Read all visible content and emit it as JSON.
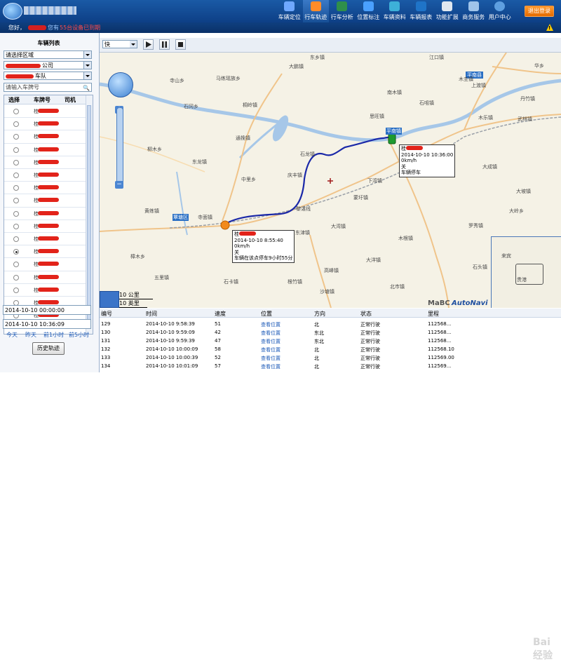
{
  "nav": {
    "items": [
      {
        "label": "车辆定位",
        "color": "#6fa8ff"
      },
      {
        "label": "行车轨迹",
        "color": "#ff8c2a"
      },
      {
        "label": "行车分析",
        "color": "#2f8f4a"
      },
      {
        "label": "位置标注",
        "color": "#4aa0ff"
      },
      {
        "label": "车辆资料",
        "color": "#3db0d8"
      },
      {
        "label": "车辆报表",
        "color": "#1f74c8"
      },
      {
        "label": "功能扩展",
        "color": "#e0e8f0"
      },
      {
        "label": "商务服务",
        "color": "#9fc4ea"
      },
      {
        "label": "用户中心",
        "color": "#5e9fe0"
      }
    ],
    "logout": "退出登录"
  },
  "welcome": {
    "greeting": "您好，",
    "you_have": "您有",
    "notice": "55台设备已到期"
  },
  "sidebar": {
    "title": "车辆列表",
    "region_select": "请选择区域",
    "company_select": "公司",
    "fleet_select": "车队",
    "search_placeholder": "请输入车牌号",
    "columns": {
      "select": "选择",
      "plate": "车牌号",
      "driver": "司机"
    },
    "plate_prefix": "桂",
    "start_time": "2014-10-10 00:00:00",
    "end_time": "2014-10-10 10:36:09",
    "quick": {
      "today": "今天",
      "yesterday": "昨天",
      "hour1": "前1小时",
      "hour5": "前5小时"
    },
    "history_button": "历史轨迹"
  },
  "playback": {
    "speed": "快"
  },
  "map": {
    "places": [
      "东乡镇",
      "江口镇",
      "华乡",
      "平南县",
      "寺山乡",
      "马练瑶族乡",
      "大鹏镇",
      "木圭镇",
      "上渡镇",
      "南木镇",
      "丹竹镇",
      "石冈乡",
      "桐岭镇",
      "石咀镇",
      "思旺镇",
      "木乐镇",
      "武林镇",
      "通挽镇",
      "平南镇",
      "大成镇",
      "柳木乡",
      "东龙镇",
      "石龙镇",
      "庆丰镇",
      "中里乡",
      "下湾镇",
      "大坡镇",
      "黄练镇",
      "覃塘区",
      "黎湛线",
      "大岭乡",
      "寺面镇",
      "蒙圩镇",
      "罗秀镇",
      "东津镇",
      "木根镇",
      "大湾镇",
      "石卡镇",
      "大洋镇",
      "高峰镇",
      "石头镇",
      "樟木乡",
      "五里镇",
      "根竹镇",
      "沙塘镇",
      "北市镇",
      "六陈镇",
      "桥圩镇",
      "八塘镇",
      "黄林镇",
      "大沟镇",
      "来宾",
      "贵港",
      "石卡镇",
      "桂平市",
      "石咀镇",
      "白沙镇",
      "峡州镇"
    ],
    "end_marker": {
      "plate": "桂",
      "time": "2014-10-10 10:36:00",
      "speed": "0km/h",
      "status": "关",
      "event": "车辆停车"
    },
    "start_marker": {
      "plate": "桂",
      "time": "2014-10-10 8:55:40",
      "speed": "0km/h",
      "status": "关",
      "event": "车辆在该点停车9小时55分"
    },
    "scale_km": "10 公里",
    "scale_mi": "10 英里",
    "brand_a": "MaBC",
    "brand_b": "AutoNavi",
    "minimap_a": "来宾",
    "minimap_b": "贵港"
  },
  "records": {
    "columns": {
      "id": "编号",
      "time": "时间",
      "speed": "速度",
      "location": "位置",
      "direction": "方向",
      "status": "状态",
      "mileage": "里程"
    },
    "rows": [
      {
        "id": "129",
        "time": "2014-10-10 9:58:39",
        "speed": "51",
        "location": "查看位置",
        "direction": "北",
        "status": "正常行驶",
        "mileage": "112568..."
      },
      {
        "id": "130",
        "time": "2014-10-10 9:59:09",
        "speed": "42",
        "location": "查看位置",
        "direction": "东北",
        "status": "正常行驶",
        "mileage": "112568..."
      },
      {
        "id": "131",
        "time": "2014-10-10 9:59:39",
        "speed": "47",
        "location": "查看位置",
        "direction": "东北",
        "status": "正常行驶",
        "mileage": "112568..."
      },
      {
        "id": "132",
        "time": "2014-10-10 10:00:09",
        "speed": "58",
        "location": "查看位置",
        "direction": "北",
        "status": "正常行驶",
        "mileage": "112568.10"
      },
      {
        "id": "133",
        "time": "2014-10-10 10:00:39",
        "speed": "52",
        "location": "查看位置",
        "direction": "北",
        "status": "正常行驶",
        "mileage": "112569.00"
      },
      {
        "id": "134",
        "time": "2014-10-10 10:01:09",
        "speed": "57",
        "location": "查看位置",
        "direction": "北",
        "status": "正常行驶",
        "mileage": "112569..."
      }
    ]
  },
  "watermark": "Bai 经验"
}
